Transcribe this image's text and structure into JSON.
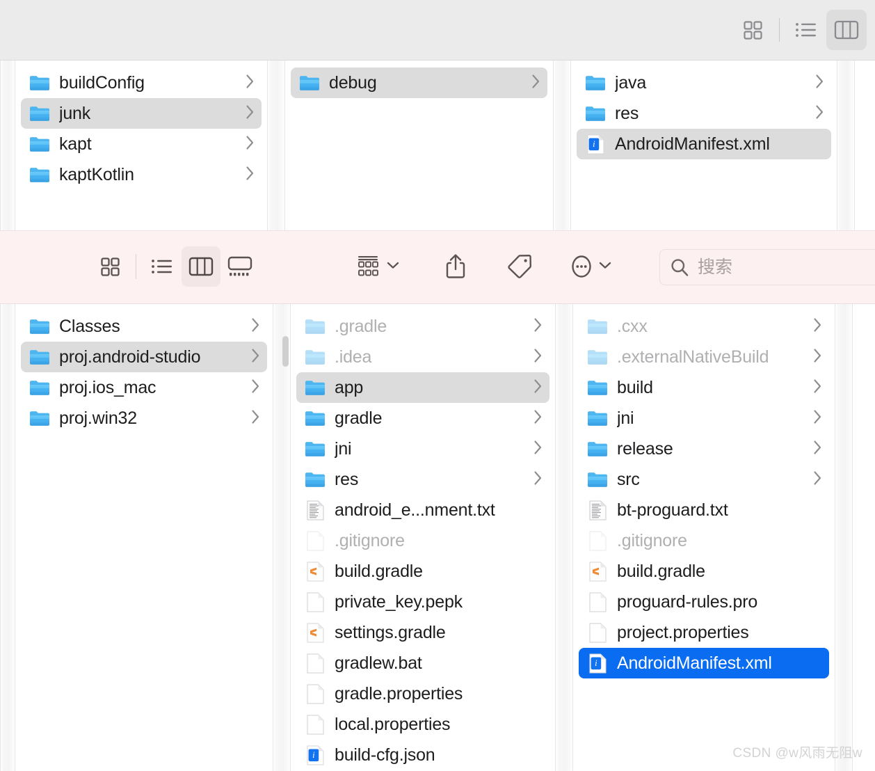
{
  "top_window": {
    "toolbar": {
      "view_buttons": [
        {
          "name": "icon-view",
          "label": "Icon View",
          "active": false
        },
        {
          "name": "list-view",
          "label": "List View",
          "active": false
        },
        {
          "name": "column-view",
          "label": "Column View",
          "active": true
        }
      ]
    },
    "columns": [
      {
        "name": "column-1",
        "items": [
          {
            "label": "buildConfig",
            "type": "folder",
            "chevron": true,
            "state": "normal"
          },
          {
            "label": "junk",
            "type": "folder",
            "chevron": true,
            "state": "selected-inactive"
          },
          {
            "label": "kapt",
            "type": "folder",
            "chevron": true,
            "state": "normal"
          },
          {
            "label": "kaptKotlin",
            "type": "folder",
            "chevron": true,
            "state": "normal"
          }
        ]
      },
      {
        "name": "column-2",
        "items": [
          {
            "label": "debug",
            "type": "folder",
            "chevron": true,
            "state": "selected-inactive"
          }
        ]
      },
      {
        "name": "column-3",
        "items": [
          {
            "label": "java",
            "type": "folder",
            "chevron": true,
            "state": "normal"
          },
          {
            "label": "res",
            "type": "folder",
            "chevron": true,
            "state": "normal"
          },
          {
            "label": "AndroidManifest.xml",
            "type": "xml",
            "chevron": false,
            "state": "selected-inactive"
          }
        ]
      }
    ]
  },
  "mid_toolbar": {
    "view_buttons": [
      {
        "name": "icon-view",
        "label": "Icon View",
        "active": false
      },
      {
        "name": "list-view",
        "label": "List View",
        "active": false
      },
      {
        "name": "column-view",
        "label": "Column View",
        "active": true
      },
      {
        "name": "gallery-view",
        "label": "Gallery View",
        "active": false
      }
    ],
    "actions": [
      {
        "name": "group-by-button",
        "label": "Group Items",
        "caret": true
      },
      {
        "name": "share-button",
        "label": "Share",
        "caret": false
      },
      {
        "name": "tag-button",
        "label": "Tags",
        "caret": false
      },
      {
        "name": "more-actions-button",
        "label": "More",
        "caret": true
      }
    ],
    "search": {
      "placeholder": "搜索",
      "value": ""
    }
  },
  "bottom_window": {
    "columns": [
      {
        "name": "column-1",
        "items": [
          {
            "label": "Classes",
            "type": "folder",
            "chevron": true,
            "state": "normal"
          },
          {
            "label": "proj.android-studio",
            "type": "folder",
            "chevron": true,
            "state": "selected-inactive"
          },
          {
            "label": "proj.ios_mac",
            "type": "folder",
            "chevron": true,
            "state": "normal"
          },
          {
            "label": "proj.win32",
            "type": "folder",
            "chevron": true,
            "state": "normal"
          }
        ]
      },
      {
        "name": "column-2",
        "items": [
          {
            "label": ".gradle",
            "type": "folder",
            "chevron": true,
            "state": "dimmed"
          },
          {
            "label": ".idea",
            "type": "folder",
            "chevron": true,
            "state": "dimmed"
          },
          {
            "label": "app",
            "type": "folder",
            "chevron": true,
            "state": "selected-inactive"
          },
          {
            "label": "gradle",
            "type": "folder",
            "chevron": true,
            "state": "normal"
          },
          {
            "label": "jni",
            "type": "folder",
            "chevron": true,
            "state": "normal"
          },
          {
            "label": "res",
            "type": "folder",
            "chevron": true,
            "state": "normal"
          },
          {
            "label": "android_e...nment.txt",
            "type": "text",
            "chevron": false,
            "state": "normal"
          },
          {
            "label": ".gitignore",
            "type": "blank",
            "chevron": false,
            "state": "dimmed"
          },
          {
            "label": "build.gradle",
            "type": "sublime",
            "chevron": false,
            "state": "normal"
          },
          {
            "label": "private_key.pepk",
            "type": "blank",
            "chevron": false,
            "state": "normal"
          },
          {
            "label": "settings.gradle",
            "type": "sublime",
            "chevron": false,
            "state": "normal"
          },
          {
            "label": "gradlew.bat",
            "type": "blank",
            "chevron": false,
            "state": "normal"
          },
          {
            "label": "gradle.properties",
            "type": "blank",
            "chevron": false,
            "state": "normal"
          },
          {
            "label": "local.properties",
            "type": "blank",
            "chevron": false,
            "state": "normal"
          },
          {
            "label": "build-cfg.json",
            "type": "xml",
            "chevron": false,
            "state": "normal"
          }
        ]
      },
      {
        "name": "column-3",
        "items": [
          {
            "label": ".cxx",
            "type": "folder",
            "chevron": true,
            "state": "dimmed"
          },
          {
            "label": ".externalNativeBuild",
            "type": "folder",
            "chevron": true,
            "state": "dimmed"
          },
          {
            "label": "build",
            "type": "folder",
            "chevron": true,
            "state": "normal"
          },
          {
            "label": "jni",
            "type": "folder",
            "chevron": true,
            "state": "normal"
          },
          {
            "label": "release",
            "type": "folder",
            "chevron": true,
            "state": "normal"
          },
          {
            "label": "src",
            "type": "folder",
            "chevron": true,
            "state": "normal"
          },
          {
            "label": "bt-proguard.txt",
            "type": "text",
            "chevron": false,
            "state": "normal"
          },
          {
            "label": ".gitignore",
            "type": "blank",
            "chevron": false,
            "state": "dimmed"
          },
          {
            "label": "build.gradle",
            "type": "sublime",
            "chevron": false,
            "state": "normal"
          },
          {
            "label": "proguard-rules.pro",
            "type": "blank",
            "chevron": false,
            "state": "normal"
          },
          {
            "label": "project.properties",
            "type": "blank",
            "chevron": false,
            "state": "normal"
          },
          {
            "label": "AndroidManifest.xml",
            "type": "xml",
            "chevron": false,
            "state": "selected-active"
          }
        ]
      }
    ]
  },
  "watermark": {
    "text": "CSDN @w风雨无阻w"
  },
  "colors": {
    "selection_blue": "#0a6cf0",
    "selection_gray": "#dddcdc",
    "toolbar_gray": "#ecebeb",
    "toolbar_pink": "#fdf1f1",
    "folder_blue": "#54bdf6",
    "sublime_orange": "#ef8b33"
  }
}
